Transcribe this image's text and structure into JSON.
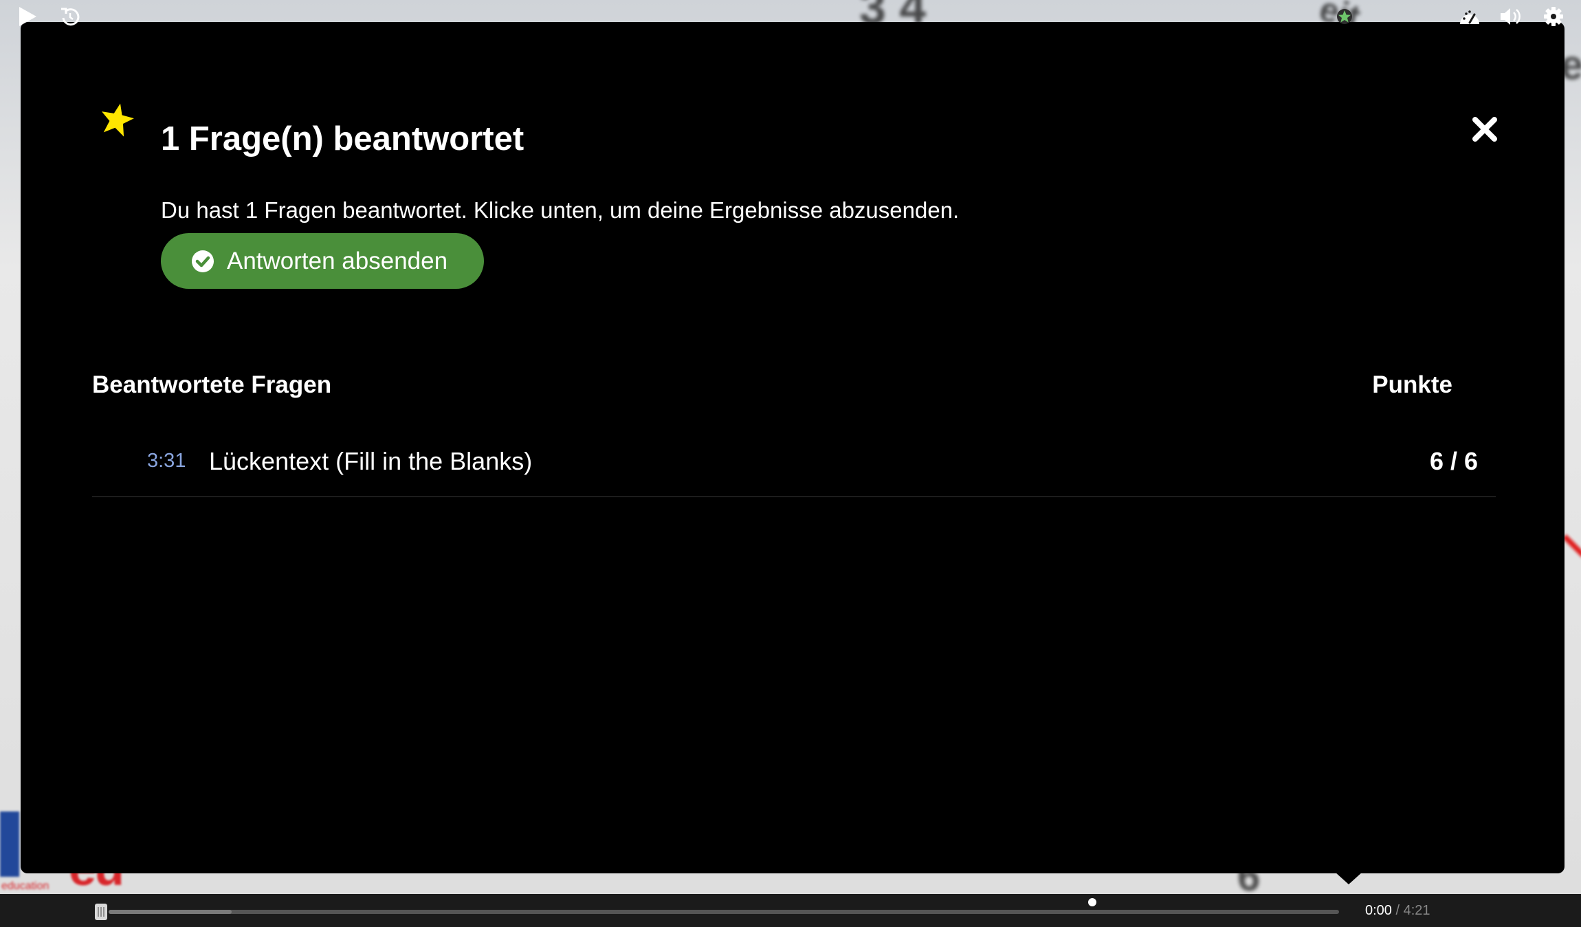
{
  "dialog": {
    "title": "1 Frage(n) beantwortet",
    "message": "Du hast 1 Fragen beantwortet. Klicke unten, um deine Ergebnisse abzusenden.",
    "submit_label": "Antworten absenden",
    "answered_heading": "Beantwortete Fragen",
    "points_heading": "Punkte",
    "questions": [
      {
        "time": "3:31",
        "title": "Lückentext (Fill in the Blanks)",
        "score": "6 / 6"
      }
    ]
  },
  "player": {
    "current_time": "0:00",
    "separator": "/",
    "duration": "4:21",
    "buffered_fraction": 0.1,
    "played_fraction": 0.0
  },
  "background": {
    "logo_text": "eu",
    "logo_subtext": "education"
  },
  "colors": {
    "dialog_bg": "#000000",
    "submit_green": "#4a8f3a",
    "star_yellow": "#ffe600",
    "time_link": "#8aa6e0",
    "controlbar_bg": "#1b1b1b"
  },
  "icons": {
    "star": "star-icon",
    "close": "close-icon",
    "check": "check-circle-icon",
    "play": "play-icon",
    "rewind": "rewind-10-icon",
    "bookmarks": "bookmarks-icon",
    "summary_star": "summary-star-icon",
    "speed": "playback-rate-icon",
    "volume": "volume-icon",
    "settings": "gear-icon"
  }
}
